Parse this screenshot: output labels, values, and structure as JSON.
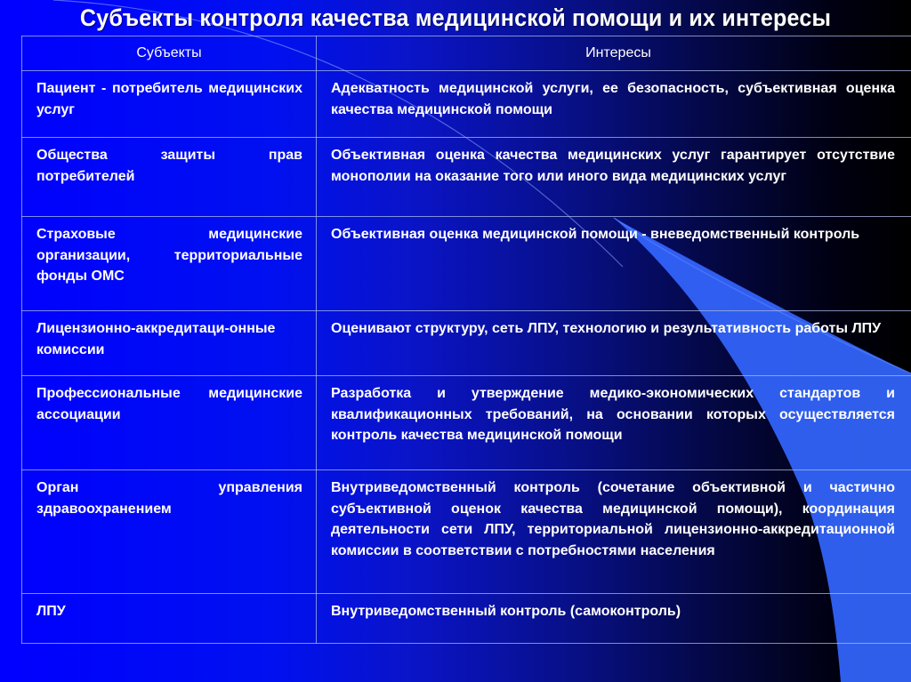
{
  "slide": {
    "title": "Субъекты контроля качества медицинской помощи и их интересы"
  },
  "table": {
    "headers": {
      "subjects": "Субъекты",
      "interests": "Интересы"
    },
    "rows": [
      {
        "subject": "Пациент - потребитель медицинских услуг",
        "interest": "Адекватность медицинской услуги, ее безопасность, субъективная оценка качества медицинской помощи"
      },
      {
        "subject": "Общества защиты прав потребителей",
        "interest": "Объективная оценка качества медицинских услуг гарантирует отсутствие монополии на оказание того или иного вида медицинских услуг"
      },
      {
        "subject": "Страховые медицинские организации, территориальные фонды ОМС",
        "interest": "Объективная оценка медицинской помощи - вневедомственный контроль"
      },
      {
        "subject": "Лицензионно-аккредитаци-онные комиссии",
        "interest": "Оценивают структуру, сеть ЛПУ, технологию и результативность работы ЛПУ"
      },
      {
        "subject": "Профессиональные медицинские ассоциации",
        "interest": "Разработка и утверждение медико-экономических стандартов и квалификационных требований, на основании которых осуществляется контроль качества медицинской помощи"
      },
      {
        "subject": "Орган управления здравоохранением",
        "interest": "Внутриведомственный контроль (сочетание объективной и частично субъективной оценок качества медицинской помощи), координация деятельности сети ЛПУ, территориальной лицензионно-аккредитационной комиссии в соответствии с потребностями населения"
      },
      {
        "subject": "ЛПУ",
        "interest": "Внутриведомственный контроль (самоконтроль)"
      }
    ]
  },
  "theme": {
    "background_start": "#0000ff",
    "background_end": "#000000",
    "accent_curve": "#3366ff",
    "text_color": "#ffffff",
    "border_color": "#aab9e6"
  }
}
